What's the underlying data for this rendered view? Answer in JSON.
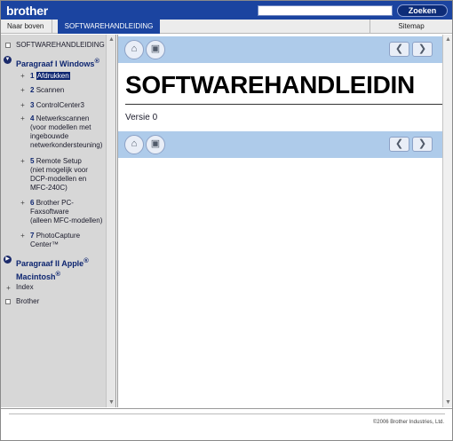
{
  "header": {
    "logo": "brother",
    "search_placeholder": "",
    "search_button": "Zoeken"
  },
  "navbar": {
    "up_label": "Naar boven",
    "tab_label": "SOFTWAREHANDLEIDING",
    "sitemap_label": "Sitemap"
  },
  "sidebar": {
    "top_item": "SOFTWAREHANDLEIDING",
    "section1": "Paragraaf I Windows",
    "section1_sup": "®",
    "items": [
      {
        "num": "1",
        "label": "Afdrukken"
      },
      {
        "num": "2",
        "label": "Scannen"
      },
      {
        "num": "3",
        "label": "ControlCenter3"
      },
      {
        "num": "4",
        "label": "Netwerkscannen",
        "lines": [
          "(voor modellen met",
          "ingebouwde",
          "netwerkondersteuning)"
        ]
      },
      {
        "num": "5",
        "label": "Remote Setup",
        "lines": [
          "(niet mogelijk voor",
          "DCP-modellen en",
          "MFC-240C)"
        ]
      },
      {
        "num": "6",
        "label": "Brother PC-",
        "lines": [
          "Faxsoftware",
          "(alleen MFC-modellen)"
        ]
      },
      {
        "num": "7",
        "label": "PhotoCapture",
        "lines": [
          "Center™"
        ]
      }
    ],
    "section2_line1": "Paragraaf II Apple",
    "section2_sup1": "®",
    "section2_line2": "Macintosh",
    "section2_sup2": "®",
    "index": "Index",
    "brother": "Brother"
  },
  "main": {
    "title": "SOFTWAREHANDLEIDIN",
    "version": "Versie 0"
  },
  "footer": {
    "copyright": "©2006 Brother Industries, Ltd."
  },
  "colors": {
    "brand_blue": "#1b44a0",
    "toolbar_blue": "#aecbea",
    "sidebar_grey": "#d7d7d7"
  }
}
